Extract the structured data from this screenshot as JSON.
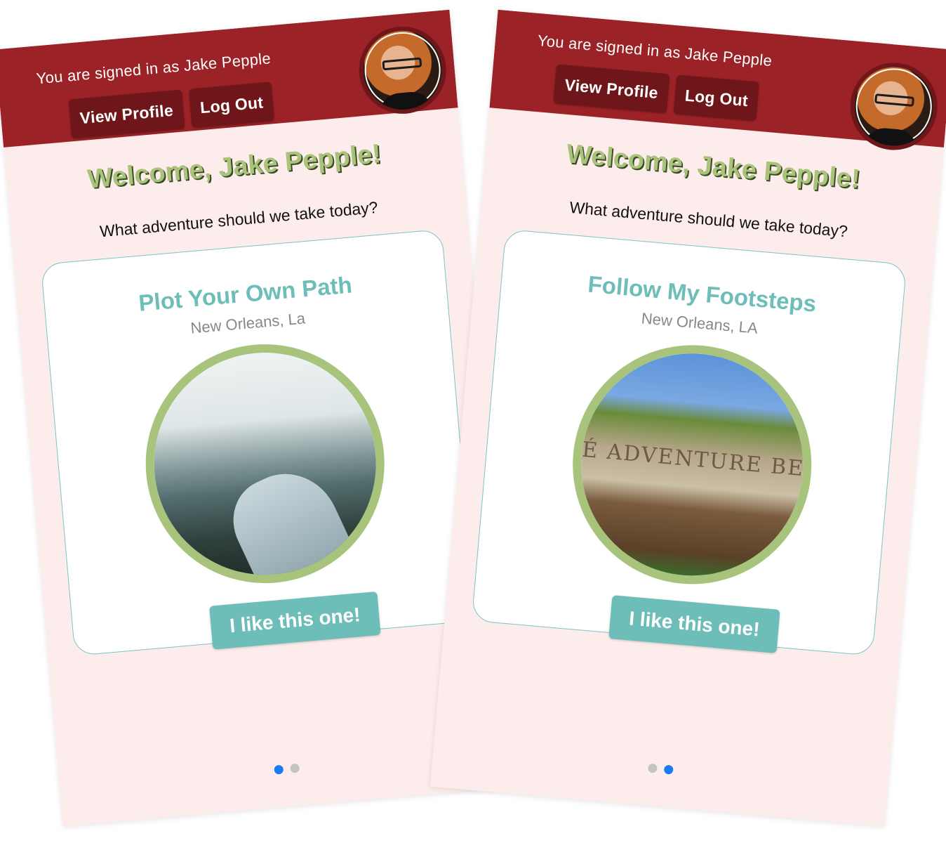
{
  "colors": {
    "header": "#9b2226",
    "header_button": "#6e1619",
    "background": "#fdecec",
    "welcome_text": "#a9c47a",
    "accent_teal": "#6dbdb8",
    "photo_border": "#a8c47c",
    "dot_active": "#1a7cf3",
    "dot_inactive": "#c4c4c4"
  },
  "screens": [
    {
      "header": {
        "signed_in_text": "You are signed in as Jake Pepple",
        "view_profile_label": "View Profile",
        "log_out_label": "Log Out",
        "avatar_icon": "user-avatar"
      },
      "welcome": "Welcome, Jake Pepple!",
      "prompt": "What adventure should we take today?",
      "card": {
        "title": "Plot Your Own Path",
        "subtitle": "New Orleans, La",
        "image": "mountain-lake-photo",
        "button_label": "I like this one!"
      },
      "pager": {
        "total": 2,
        "active_index": 0
      }
    },
    {
      "header": {
        "signed_in_text": "You are signed in as Jake Pepple",
        "view_profile_label": "View Profile",
        "log_out_label": "Log Out",
        "avatar_icon": "user-avatar"
      },
      "welcome": "Welcome, Jake Pepple!",
      "prompt": "What adventure should we take today?",
      "card": {
        "title": "Follow My Footsteps",
        "subtitle": "New Orleans, LA",
        "image": "ruin-archway-photo",
        "image_text": "É ADVENTURE BEGIN",
        "button_label": "I like this one!"
      },
      "pager": {
        "total": 2,
        "active_index": 1
      }
    }
  ]
}
